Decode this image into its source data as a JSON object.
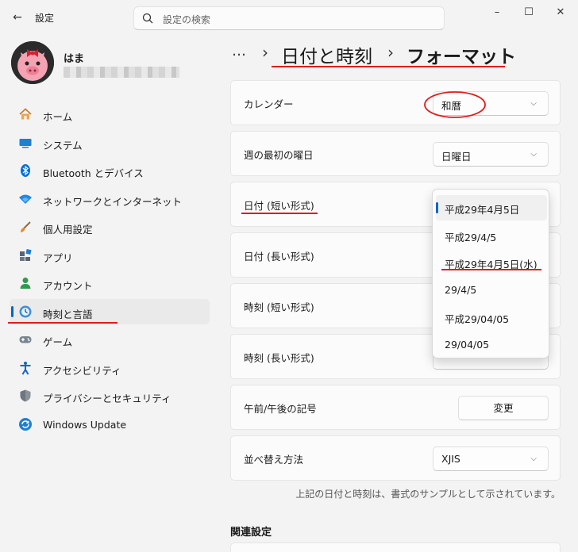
{
  "titlebar": {
    "title": "設定",
    "search_placeholder": "設定の検索",
    "minimize": "–",
    "maximize": "☐",
    "close": "✕"
  },
  "user": {
    "name": "はま"
  },
  "nav": [
    {
      "label": "ホーム",
      "icon": "home-icon"
    },
    {
      "label": "システム",
      "icon": "system-icon"
    },
    {
      "label": "Bluetooth とデバイス",
      "icon": "bluetooth-icon"
    },
    {
      "label": "ネットワークとインターネット",
      "icon": "wifi-icon"
    },
    {
      "label": "個人用設定",
      "icon": "brush-icon"
    },
    {
      "label": "アプリ",
      "icon": "apps-icon"
    },
    {
      "label": "アカウント",
      "icon": "account-icon"
    },
    {
      "label": "時刻と言語",
      "icon": "time-language-icon",
      "active": true
    },
    {
      "label": "ゲーム",
      "icon": "gamepad-icon"
    },
    {
      "label": "アクセシビリティ",
      "icon": "accessibility-icon"
    },
    {
      "label": "プライバシーとセキュリティ",
      "icon": "shield-icon"
    },
    {
      "label": "Windows Update",
      "icon": "update-icon"
    }
  ],
  "breadcrumb": {
    "ellipsis": "…",
    "sep": "›",
    "parent": "日付と時刻",
    "current": "フォーマット"
  },
  "rows": {
    "calendar": {
      "label": "カレンダー",
      "value": "和暦"
    },
    "first_day": {
      "label": "週の最初の曜日",
      "value": "日曜日"
    },
    "short_date": {
      "label": "日付 (短い形式)"
    },
    "long_date": {
      "label": "日付 (長い形式)"
    },
    "short_time": {
      "label": "時刻 (短い形式)"
    },
    "long_time": {
      "label": "時刻 (長い形式)"
    },
    "ampm": {
      "label": "午前/午後の記号",
      "button": "変更"
    },
    "sort": {
      "label": "並べ替え方法",
      "value": "XJIS"
    }
  },
  "dropdown": {
    "options": [
      "平成29年4月5日",
      "平成29/4/5",
      "平成29年4月5日(水)",
      "29/4/5",
      "平成29/04/05",
      "29/04/05"
    ],
    "selected_index": 0
  },
  "note": "上記の日付と時刻は、書式のサンプルとして示されています。",
  "related": "関連設定",
  "colors": {
    "accent": "#0067c0",
    "annotation_red": "#e01b1b"
  }
}
